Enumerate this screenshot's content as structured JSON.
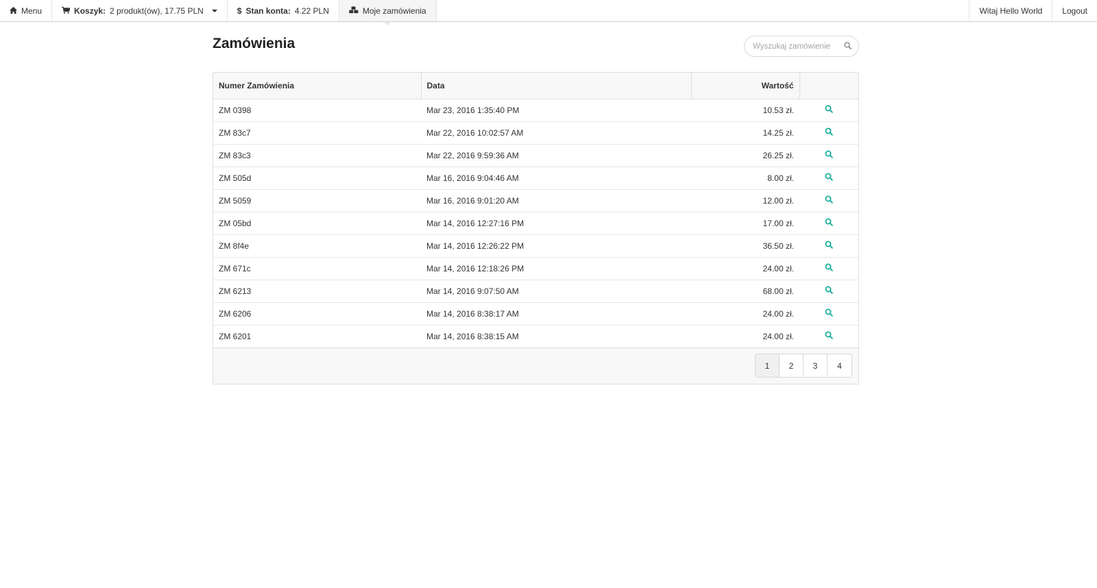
{
  "navbar": {
    "menu_label": "Menu",
    "cart_label": "Koszyk:",
    "cart_value": "2 produkt(ów), 17.75 PLN",
    "balance_label": "Stan konta:",
    "balance_value": "4.22 PLN",
    "orders_label": "Moje zamówienia",
    "welcome": "Witaj Hello World",
    "logout": "Logout"
  },
  "page": {
    "title": "Zamówienia",
    "search_placeholder": "Wyszukaj zamówienie"
  },
  "table": {
    "columns": [
      "Numer Zamówienia",
      "Data",
      "Wartość",
      ""
    ],
    "rows": [
      {
        "number": "ZM 0398",
        "date": "Mar 23, 2016 1:35:40 PM",
        "value": "10.53 zł."
      },
      {
        "number": "ZM 83c7",
        "date": "Mar 22, 2016 10:02:57 AM",
        "value": "14.25 zł."
      },
      {
        "number": "ZM 83c3",
        "date": "Mar 22, 2016 9:59:36 AM",
        "value": "26.25 zł."
      },
      {
        "number": "ZM 505d",
        "date": "Mar 16, 2016 9:04:46 AM",
        "value": "8.00 zł."
      },
      {
        "number": "ZM 5059",
        "date": "Mar 16, 2016 9:01:20 AM",
        "value": "12.00 zł."
      },
      {
        "number": "ZM 05bd",
        "date": "Mar 14, 2016 12:27:16 PM",
        "value": "17.00 zł."
      },
      {
        "number": "ZM 8f4e",
        "date": "Mar 14, 2016 12:26:22 PM",
        "value": "36.50 zł."
      },
      {
        "number": "ZM 671c",
        "date": "Mar 14, 2016 12:18:26 PM",
        "value": "24.00 zł."
      },
      {
        "number": "ZM 6213",
        "date": "Mar 14, 2016 9:07:50 AM",
        "value": "68.00 zł."
      },
      {
        "number": "ZM 6206",
        "date": "Mar 14, 2016 8:38:17 AM",
        "value": "24.00 zł."
      },
      {
        "number": "ZM 6201",
        "date": "Mar 14, 2016 8:38:15 AM",
        "value": "24.00 zł."
      }
    ]
  },
  "pagination": {
    "pages": [
      "1",
      "2",
      "3",
      "4"
    ],
    "current": "1"
  },
  "icons": {
    "menu": "home-icon",
    "cart": "shopping-cart-icon",
    "balance": "dollar-icon",
    "orders": "cubes-icon",
    "search": "search-icon",
    "row_action": "magnifier-icon"
  },
  "colors": {
    "accent": "#1aaf9e",
    "header_bg": "#f8f8f9",
    "border": "#dedede"
  }
}
